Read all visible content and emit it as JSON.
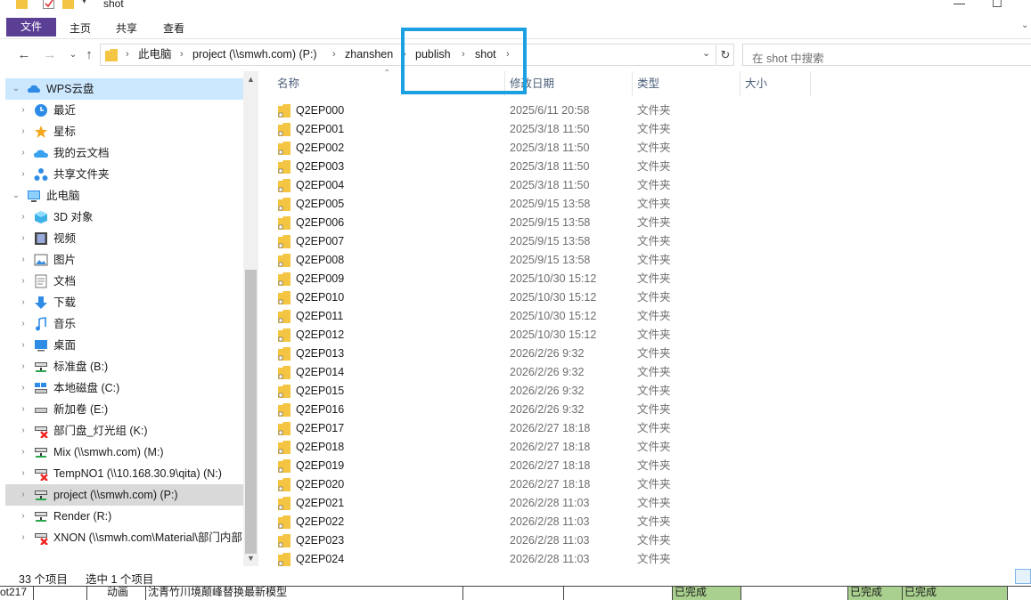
{
  "window": {
    "title": "shot"
  },
  "ribbon": {
    "tabs": [
      "文件",
      "主页",
      "共享",
      "查看"
    ]
  },
  "address": {
    "segments": [
      "此电脑",
      "project (\\\\smwh.com) (P:)",
      "zhanshen",
      "publish",
      "shot"
    ],
    "search_placeholder": "在 shot 中搜索"
  },
  "nav": {
    "items": [
      {
        "label": "WPS云盘",
        "icon": "wps-cloud-icon",
        "level": 0,
        "expanded": true,
        "selected": true
      },
      {
        "label": "最近",
        "icon": "recent-clock-icon",
        "level": 1
      },
      {
        "label": "星标",
        "icon": "star-icon",
        "level": 1
      },
      {
        "label": "我的云文档",
        "icon": "cloud-doc-icon",
        "level": 1
      },
      {
        "label": "共享文件夹",
        "icon": "shared-folder-icon",
        "level": 1
      },
      {
        "label": "此电脑",
        "icon": "this-pc-icon",
        "level": 0,
        "expanded": true
      },
      {
        "label": "3D 对象",
        "icon": "3d-objects-icon",
        "level": 1
      },
      {
        "label": "视频",
        "icon": "video-icon",
        "level": 1
      },
      {
        "label": "图片",
        "icon": "pictures-icon",
        "level": 1
      },
      {
        "label": "文档",
        "icon": "documents-icon",
        "level": 1
      },
      {
        "label": "下载",
        "icon": "download-icon",
        "level": 1
      },
      {
        "label": "音乐",
        "icon": "music-icon",
        "level": 1
      },
      {
        "label": "桌面",
        "icon": "desktop-icon",
        "level": 1
      },
      {
        "label": "标准盘 (B:)",
        "icon": "network-drive-icon",
        "level": 1
      },
      {
        "label": "本地磁盘 (C:)",
        "icon": "local-disk-icon",
        "level": 1
      },
      {
        "label": "新加卷 (E:)",
        "icon": "drive-icon",
        "level": 1
      },
      {
        "label": "部门盘_灯光组 (K:)",
        "icon": "disconnected-drive-icon",
        "level": 1
      },
      {
        "label": "Mix (\\\\smwh.com) (M:)",
        "icon": "network-drive-icon",
        "level": 1
      },
      {
        "label": "TempNO1 (\\\\10.168.30.9\\qita) (N:)",
        "icon": "disconnected-drive-icon",
        "level": 1
      },
      {
        "label": "project (\\\\smwh.com) (P:)",
        "icon": "network-drive-icon",
        "level": 1,
        "active": true
      },
      {
        "label": "Render (R:)",
        "icon": "network-drive-icon",
        "level": 1
      },
      {
        "label": "XNON (\\\\smwh.com\\Material\\部门内部",
        "icon": "disconnected-drive-icon",
        "level": 1
      }
    ]
  },
  "columns": {
    "name": "名称",
    "modified": "修改日期",
    "type": "类型",
    "size": "大小"
  },
  "files": [
    {
      "name": "Q2EP000",
      "modified": "2025/6/11 20:58",
      "type": "文件夹"
    },
    {
      "name": "Q2EP001",
      "modified": "2025/3/18 11:50",
      "type": "文件夹"
    },
    {
      "name": "Q2EP002",
      "modified": "2025/3/18 11:50",
      "type": "文件夹"
    },
    {
      "name": "Q2EP003",
      "modified": "2025/3/18 11:50",
      "type": "文件夹"
    },
    {
      "name": "Q2EP004",
      "modified": "2025/3/18 11:50",
      "type": "文件夹"
    },
    {
      "name": "Q2EP005",
      "modified": "2025/9/15 13:58",
      "type": "文件夹"
    },
    {
      "name": "Q2EP006",
      "modified": "2025/9/15 13:58",
      "type": "文件夹"
    },
    {
      "name": "Q2EP007",
      "modified": "2025/9/15 13:58",
      "type": "文件夹"
    },
    {
      "name": "Q2EP008",
      "modified": "2025/9/15 13:58",
      "type": "文件夹"
    },
    {
      "name": "Q2EP009",
      "modified": "2025/10/30 15:12",
      "type": "文件夹"
    },
    {
      "name": "Q2EP010",
      "modified": "2025/10/30 15:12",
      "type": "文件夹"
    },
    {
      "name": "Q2EP011",
      "modified": "2025/10/30 15:12",
      "type": "文件夹"
    },
    {
      "name": "Q2EP012",
      "modified": "2025/10/30 15:12",
      "type": "文件夹"
    },
    {
      "name": "Q2EP013",
      "modified": "2026/2/26 9:32",
      "type": "文件夹"
    },
    {
      "name": "Q2EP014",
      "modified": "2026/2/26 9:32",
      "type": "文件夹"
    },
    {
      "name": "Q2EP015",
      "modified": "2026/2/26 9:32",
      "type": "文件夹"
    },
    {
      "name": "Q2EP016",
      "modified": "2026/2/26 9:32",
      "type": "文件夹"
    },
    {
      "name": "Q2EP017",
      "modified": "2026/2/27 18:18",
      "type": "文件夹"
    },
    {
      "name": "Q2EP018",
      "modified": "2026/2/27 18:18",
      "type": "文件夹"
    },
    {
      "name": "Q2EP019",
      "modified": "2026/2/27 18:18",
      "type": "文件夹"
    },
    {
      "name": "Q2EP020",
      "modified": "2026/2/27 18:18",
      "type": "文件夹"
    },
    {
      "name": "Q2EP021",
      "modified": "2026/2/28 11:03",
      "type": "文件夹"
    },
    {
      "name": "Q2EP022",
      "modified": "2026/2/28 11:03",
      "type": "文件夹"
    },
    {
      "name": "Q2EP023",
      "modified": "2026/2/28 11:03",
      "type": "文件夹"
    },
    {
      "name": "Q2EP024",
      "modified": "2026/2/28 11:03",
      "type": "文件夹"
    }
  ],
  "status": {
    "count": "33 个项目",
    "selected": "选中 1 个项目"
  },
  "background_sheet": {
    "cells": [
      "ot217",
      "动画",
      "沈青竹川境颠峰替换最新模型",
      "已完成",
      "已完成",
      "已完成"
    ]
  },
  "colors": {
    "file_tab": "#5b3f94",
    "highlight_box": "#1ba1e2",
    "folder": "#f4c542",
    "selected_nav": "#cce8ff"
  }
}
